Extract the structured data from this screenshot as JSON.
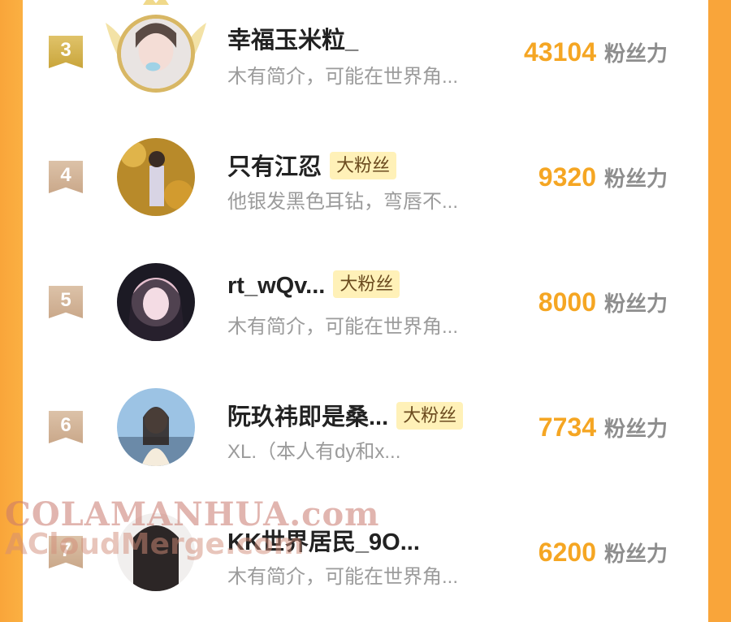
{
  "fan_unit": "粉丝力",
  "tag_label": "大粉丝",
  "rows": [
    {
      "rank": "3",
      "name": "幸福玉米粒_",
      "tag": "",
      "bio": "木有简介，可能在世界角...",
      "score": "43104"
    },
    {
      "rank": "4",
      "name": "只有江忍",
      "tag": "大粉丝",
      "bio": "他银发黑色耳钻，弯唇不...",
      "score": "9320"
    },
    {
      "rank": "5",
      "name": "rt_wQv...",
      "tag": "大粉丝",
      "bio": "木有简介，可能在世界角...",
      "score": "8000"
    },
    {
      "rank": "6",
      "name": "阮玖祎即是桑...",
      "tag": "大粉丝",
      "bio": "XL.（本人有dy和x...",
      "score": "7734"
    },
    {
      "rank": "7",
      "name": "KK世界居民_9O...",
      "tag": "",
      "bio": "木有简介，可能在世界角...",
      "score": "6200"
    }
  ],
  "watermark": {
    "line1": "COLAMANHUA.com",
    "line2": "ACloudMerge.com"
  },
  "colors": {
    "accent_orange": "#f5a623",
    "side_orange": "#f9a53a",
    "gold_badge": "#c9a53b",
    "tan_badge": "#caa88a"
  }
}
